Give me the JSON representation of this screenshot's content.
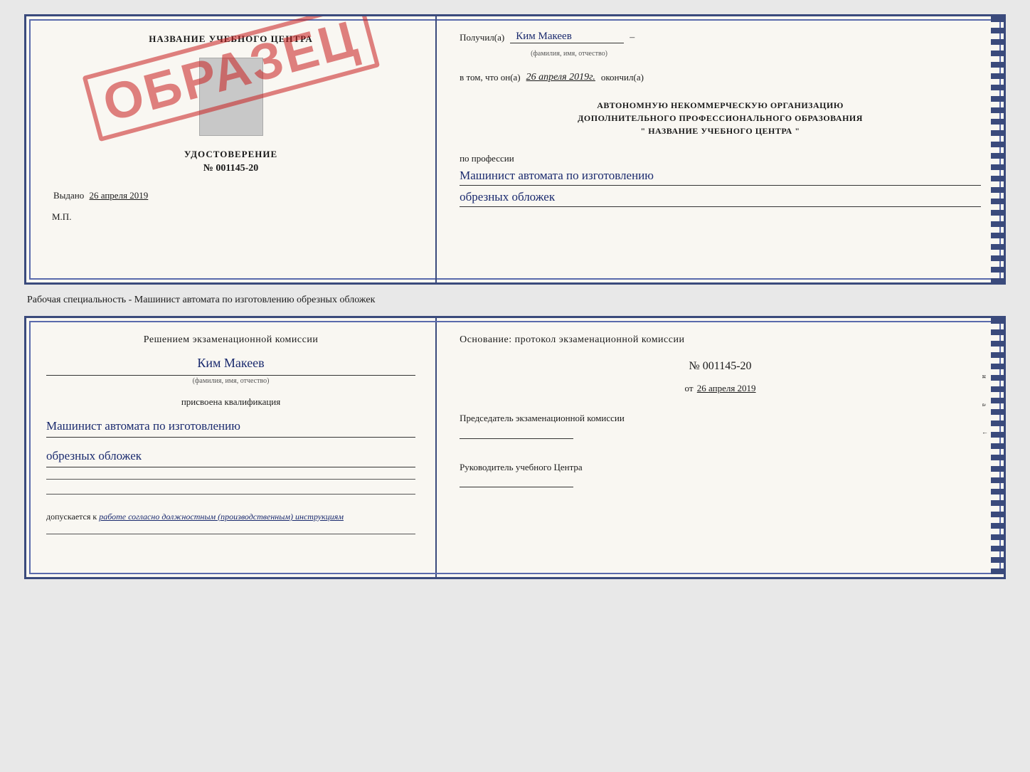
{
  "top_cert": {
    "left": {
      "school_title": "НАЗВАНИЕ УЧЕБНОГО ЦЕНТРА",
      "stamp_text": "ОБРАЗЕЦ",
      "udostoverenie_label": "УДОСТОВЕРЕНИЕ",
      "cert_number": "№ 001145-20",
      "vydano_label": "Выдано",
      "vydano_date": "26 апреля 2019",
      "mp_label": "М.П."
    },
    "right": {
      "poluchil_label": "Получил(a)",
      "recipient_name": "Ким Макеев",
      "fio_sub": "(фамилия, имя, отчество)",
      "vtom_label": "в том, что он(а)",
      "vtom_date": "26 апреля 2019г.",
      "okonchil_label": "окончил(а)",
      "org_line1": "АВТОНОМНУЮ НЕКОММЕРЧЕСКУЮ ОРГАНИЗАЦИЮ",
      "org_line2": "ДОПОЛНИТЕЛЬНОГО ПРОФЕССИОНАЛЬНОГО ОБРАЗОВАНИЯ",
      "org_name": "\"  НАЗВАНИЕ УЧЕБНОГО ЦЕНТРА  \"",
      "po_professii_label": "по профессии",
      "profession_line1": "Машинист автомата по изготовлению",
      "profession_line2": "обрезных обложек"
    }
  },
  "separator": {
    "text": "Рабочая специальность - Машинист автомата по изготовлению обрезных обложек"
  },
  "bottom_cert": {
    "left": {
      "resheniem_text": "Решением экзаменационной комиссии",
      "name_cursive": "Ким Макеев",
      "fio_sub": "(фамилия, имя, отчество)",
      "prisvoena_text": "присвоена квалификация",
      "qualification_line1": "Машинист автомата по изготовлению",
      "qualification_line2": "обрезных обложек",
      "dopuskaetsya_label": "допускается к",
      "dopuskaetsya_cursive": "работе согласно должностным (производственным) инструкциям"
    },
    "right": {
      "osnovanie_text": "Основание: протокол экзаменационной комиссии",
      "protocol_number": "№  001145-20",
      "date_prefix": "от",
      "protocol_date": "26 апреля 2019",
      "predsedatel_label": "Председатель экзаменационной комиссии",
      "rukovoditel_label": "Руководитель учебного Центра"
    }
  }
}
